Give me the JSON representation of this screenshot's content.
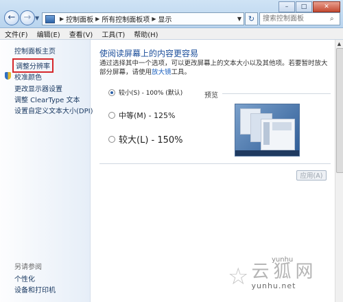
{
  "window": {
    "minimize": "–",
    "maximize": "□",
    "close": "✕"
  },
  "address_bar": {
    "breadcrumbs": [
      "控制面板",
      "所有控制面板项",
      "显示"
    ],
    "icon": "computer-icon"
  },
  "search": {
    "placeholder": "搜索控制面板"
  },
  "menu": {
    "items": [
      "文件(F)",
      "编辑(E)",
      "查看(V)",
      "工具(T)",
      "帮助(H)"
    ]
  },
  "sidebar": {
    "home": "控制面板主页",
    "links": [
      "调整分辨率",
      "校准颜色",
      "更改显示器设置",
      "调整 ClearType 文本",
      "设置自定义文本大小(DPI)"
    ],
    "see_also_title": "另请参阅",
    "see_also": [
      "个性化",
      "设备和打印机"
    ],
    "highlight_color": "#d6262a"
  },
  "main": {
    "title": "使阅读屏幕上的内容更容易",
    "description_prefix": "通过选择其中一个选项，可以更改屏幕上的文本大小以及其他项。若要暂时放大部分屏幕，请使用",
    "description_link": "放大镜",
    "description_suffix": "工具。",
    "options": [
      {
        "label": "较小(S) - 100% (默认)",
        "selected": true
      },
      {
        "label": "中等(M) - 125%",
        "selected": false
      },
      {
        "label": "较大(L) - 150%",
        "selected": false
      }
    ],
    "preview_label": "预览",
    "apply_label": "应用(A)",
    "heading_color": "#1a4d9a"
  },
  "watermark": {
    "site": "yunhu",
    "text": "云狐网",
    "domain": "yunhu.net"
  }
}
